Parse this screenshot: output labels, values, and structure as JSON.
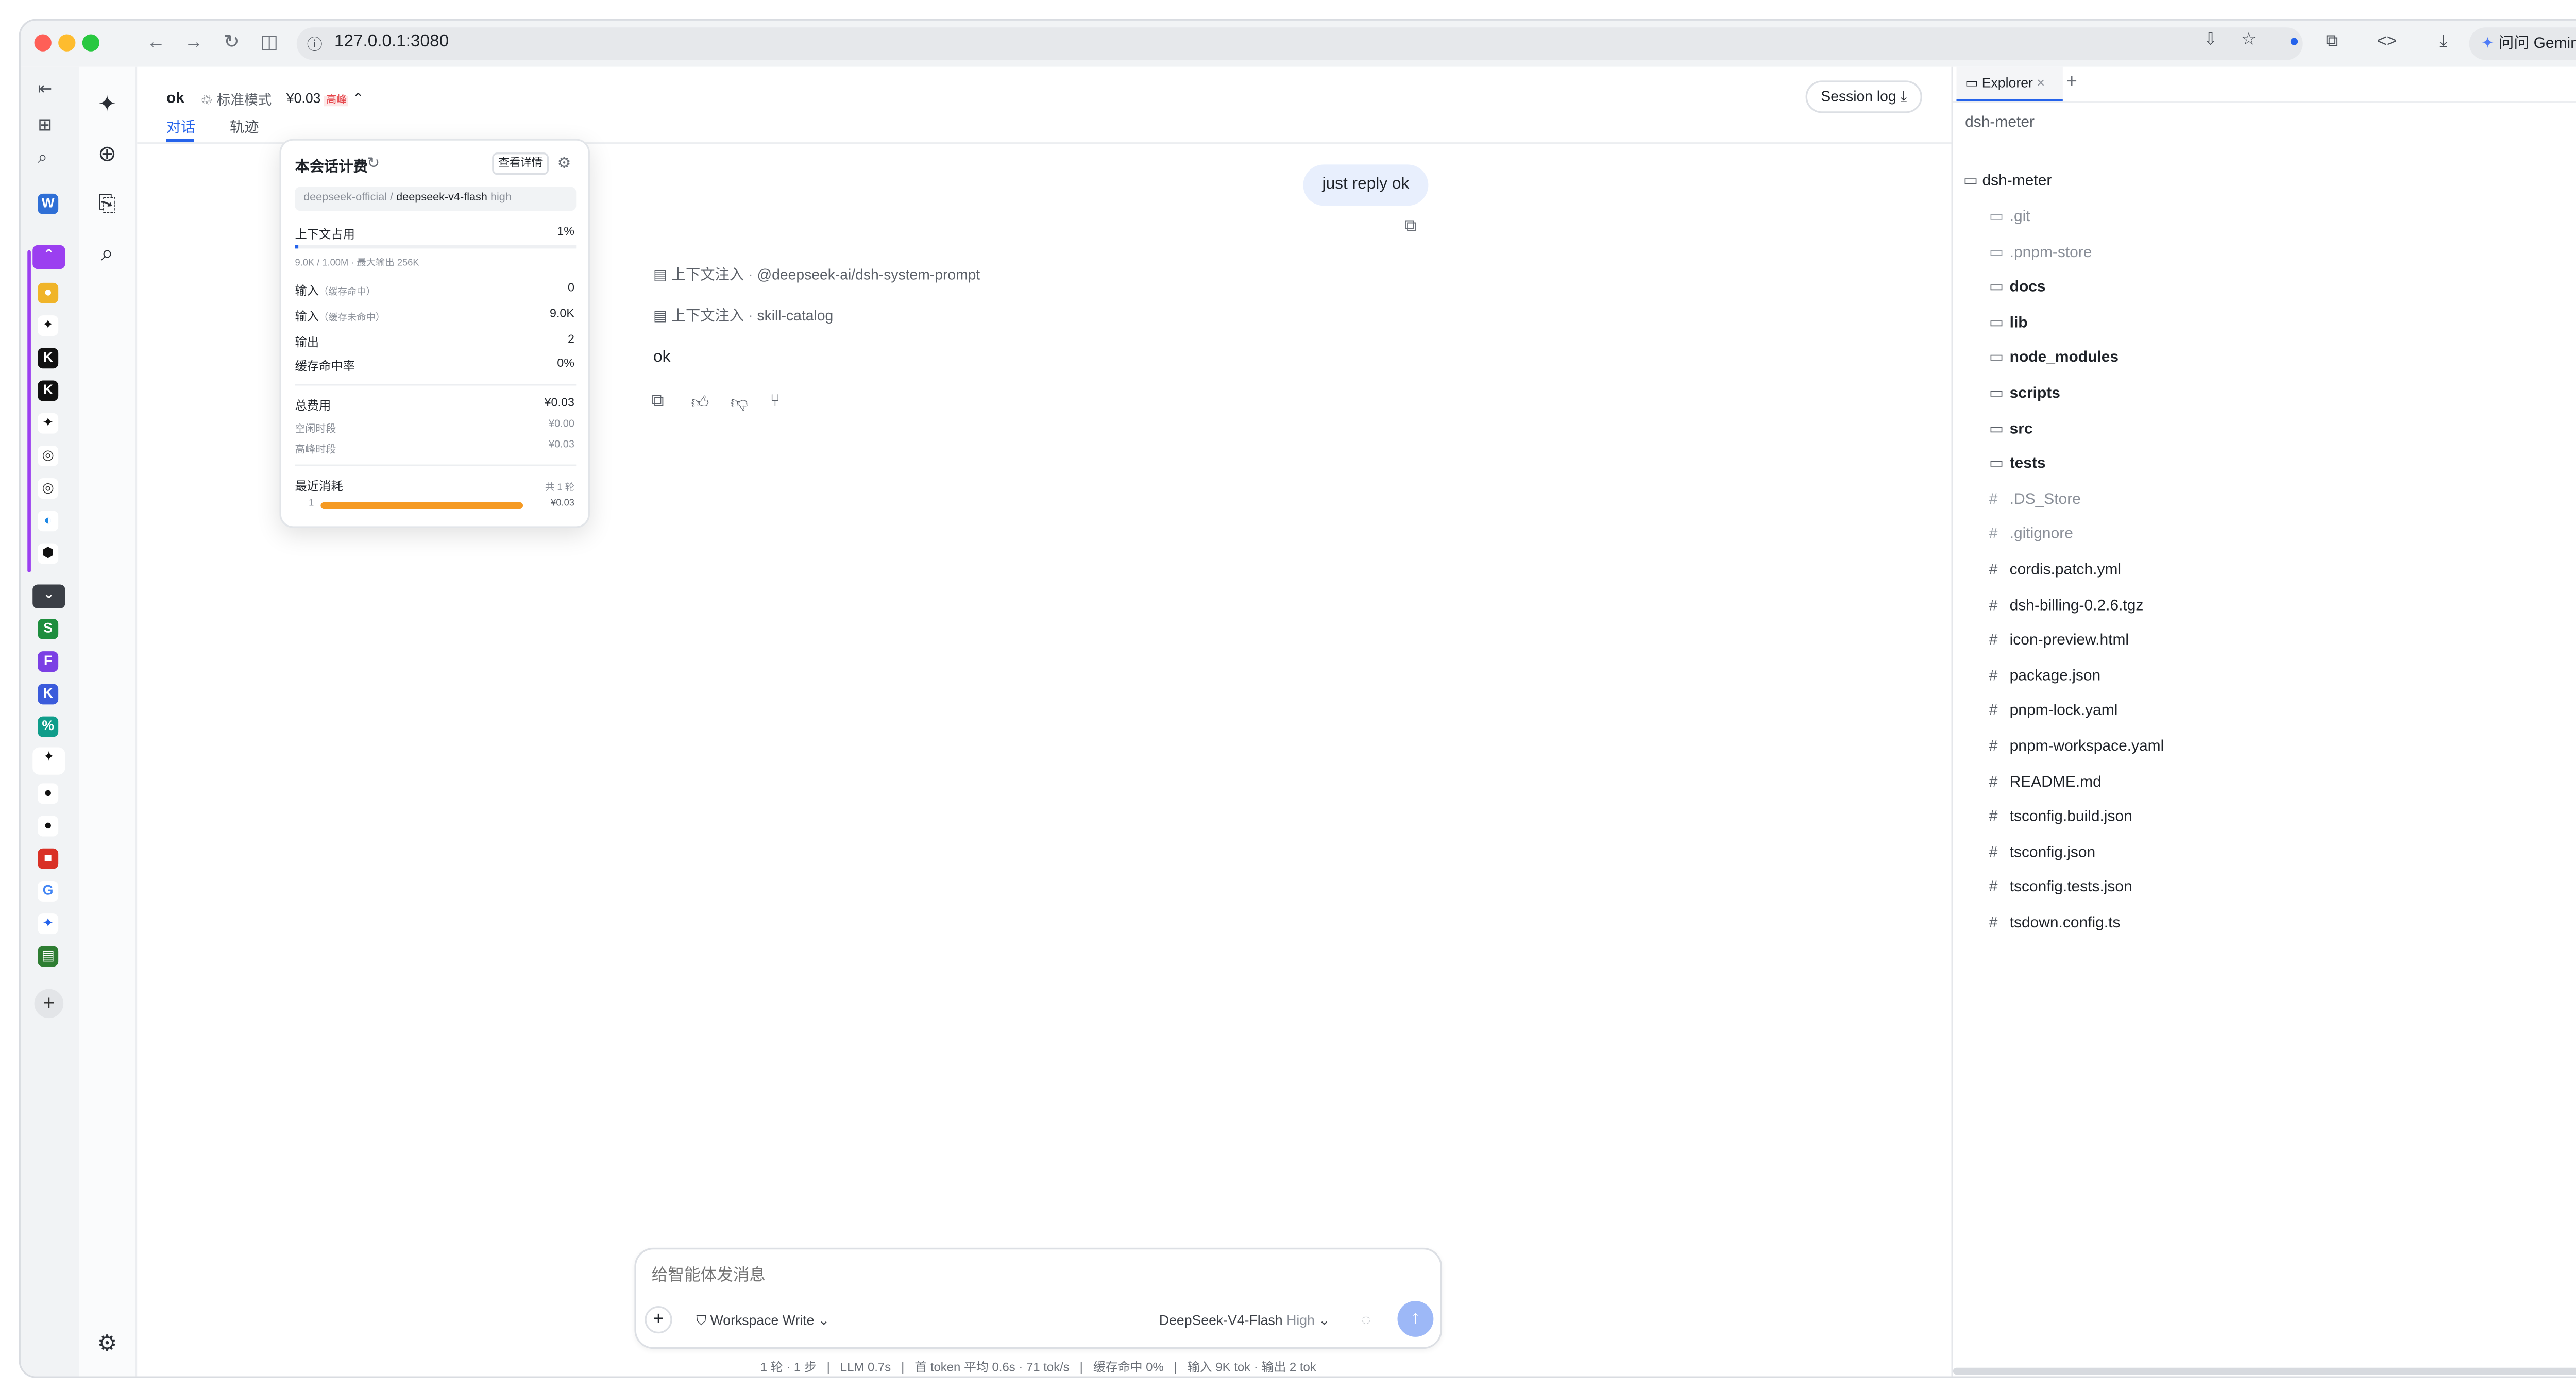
{
  "browser": {
    "url": "127.0.0.1:3080",
    "gemini_label": "问问 Gemini"
  },
  "header": {
    "title": "ok",
    "mode_label": "标准模式",
    "cost_label": "¥0.03",
    "peak_badge": "高峰",
    "tabs": [
      "对话",
      "轨迹"
    ],
    "session_log_label": "Session log"
  },
  "billing_popup": {
    "title": "本会话计费",
    "details_button": "查看详情",
    "provider": "deepseek-official /",
    "model": "deepseek-v4-flash",
    "effort": "high",
    "context_label": "上下文占用",
    "context_percent": "1%",
    "context_fill": 0.01,
    "context_detail": "9.0K / 1.00M · 最大输出 256K",
    "rows": [
      {
        "label": "输入",
        "sub": "（缓存命中）",
        "value": "0"
      },
      {
        "label": "输入",
        "sub": "（缓存未命中）",
        "value": "9.0K"
      },
      {
        "label": "输出",
        "sub": "",
        "value": "2"
      },
      {
        "label": "缓存命中率",
        "sub": "",
        "value": "0%"
      }
    ],
    "total_label": "总费用",
    "total_value": "¥0.03",
    "idle_label": "空闲时段",
    "idle_value": "¥0.00",
    "peak_label": "高峰时段",
    "peak_value": "¥0.03",
    "recent_label": "最近消耗",
    "recent_count": "共 1 轮",
    "recent_index": "1",
    "recent_value": "¥0.03",
    "recent_fill": 1.0
  },
  "chat": {
    "user_message": "just reply ok",
    "injections": [
      {
        "label": "上下文注入",
        "source": "@deepseek-ai/dsh-system-prompt"
      },
      {
        "label": "上下文注入",
        "source": "skill-catalog"
      }
    ],
    "assistant_reply": "ok"
  },
  "composer": {
    "placeholder": "给智能体发消息",
    "workspace_label": "Workspace Write",
    "model_label": "DeepSeek-V4-Flash",
    "effort_label": "High"
  },
  "status_bar": {
    "text": "1 轮 · 1 步   |   LLM 0.7s   |   首 token 平均 0.6s · 71 tok/s   |   缓存命中 0%   |   输入 9K tok · 输出 2 tok"
  },
  "explorer": {
    "tab_label": "Explorer",
    "root_label": "dsh-meter",
    "folder_label": "dsh-meter",
    "items": [
      {
        "name": ".git",
        "kind": "folder",
        "dim": true
      },
      {
        "name": ".pnpm-store",
        "kind": "folder",
        "dim": true
      },
      {
        "name": "docs",
        "kind": "folder",
        "dim": false
      },
      {
        "name": "lib",
        "kind": "folder",
        "dim": false
      },
      {
        "name": "node_modules",
        "kind": "folder",
        "dim": false
      },
      {
        "name": "scripts",
        "kind": "folder",
        "dim": false
      },
      {
        "name": "src",
        "kind": "folder",
        "dim": false
      },
      {
        "name": "tests",
        "kind": "folder",
        "dim": false
      },
      {
        "name": ".DS_Store",
        "kind": "file",
        "dim": true
      },
      {
        "name": ".gitignore",
        "kind": "file",
        "dim": true
      },
      {
        "name": "cordis.patch.yml",
        "kind": "file",
        "dim": false
      },
      {
        "name": "dsh-billing-0.2.6.tgz",
        "kind": "file",
        "dim": false
      },
      {
        "name": "icon-preview.html",
        "kind": "file",
        "dim": false
      },
      {
        "name": "package.json",
        "kind": "file",
        "dim": false
      },
      {
        "name": "pnpm-lock.yaml",
        "kind": "file",
        "dim": false
      },
      {
        "name": "pnpm-workspace.yaml",
        "kind": "file",
        "dim": false
      },
      {
        "name": "README.md",
        "kind": "file",
        "dim": false
      },
      {
        "name": "tsconfig.build.json",
        "kind": "file",
        "dim": false
      },
      {
        "name": "tsconfig.json",
        "kind": "file",
        "dim": false
      },
      {
        "name": "tsconfig.tests.json",
        "kind": "file",
        "dim": false
      },
      {
        "name": "tsdown.config.ts",
        "kind": "file",
        "dim": false
      }
    ]
  },
  "colors": {
    "accent": "#2563eb",
    "peak_red": "#e5484d",
    "bar_orange": "#f59a23",
    "send_button": "#9db8f7"
  }
}
